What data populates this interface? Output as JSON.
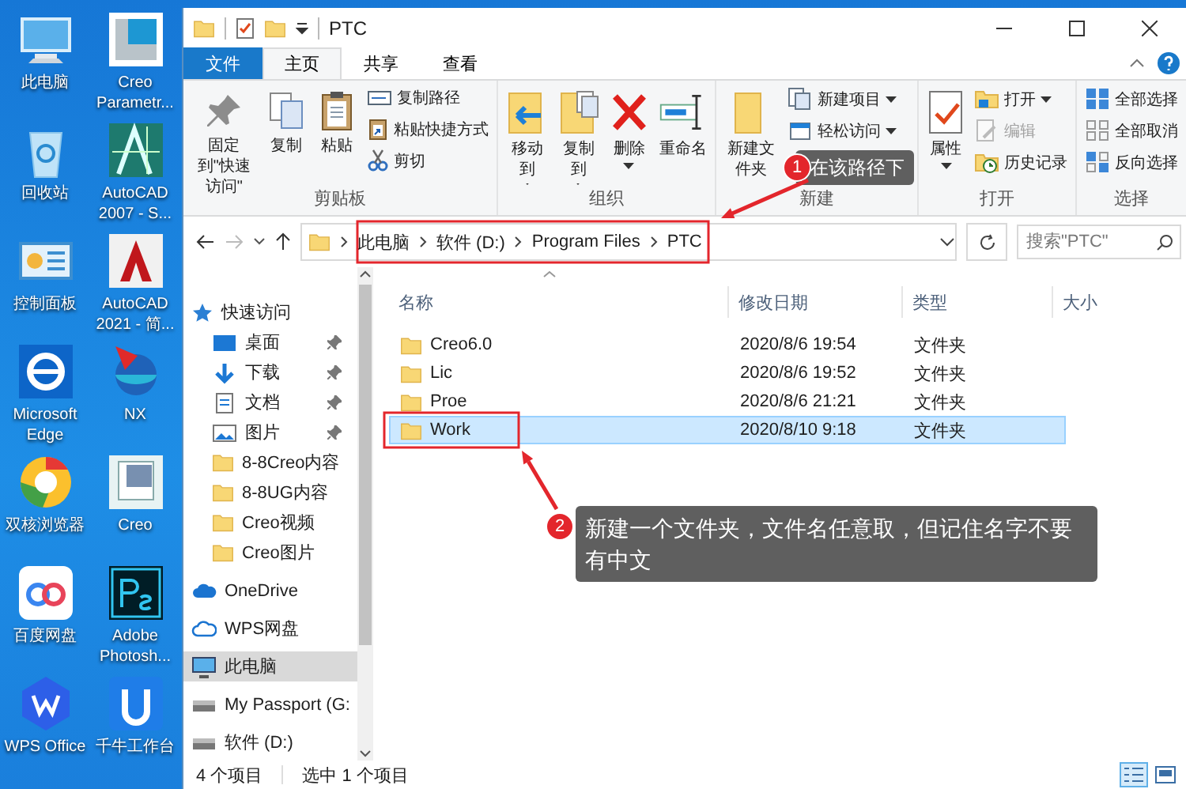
{
  "desktop_icons": [
    {
      "label": "此电脑"
    },
    {
      "label": "Creo Parametr..."
    },
    {
      "label": "回收站"
    },
    {
      "label": "AutoCAD 2007 - S..."
    },
    {
      "label": "控制面板"
    },
    {
      "label": "AutoCAD 2021 - 简..."
    },
    {
      "label": "Microsoft Edge"
    },
    {
      "label": "NX"
    },
    {
      "label": "双核浏览器"
    },
    {
      "label": "Creo"
    },
    {
      "label": "百度网盘"
    },
    {
      "label": "Adobe Photosh..."
    },
    {
      "label": "WPS Office"
    },
    {
      "label": "千牛工作台"
    }
  ],
  "window": {
    "title": "PTC"
  },
  "tabs": [
    {
      "label": "文件",
      "kind": "file",
      "selected": false
    },
    {
      "label": "主页",
      "kind": "tab",
      "selected": true
    },
    {
      "label": "共享",
      "kind": "tab",
      "selected": false
    },
    {
      "label": "查看",
      "kind": "tab",
      "selected": false
    }
  ],
  "ribbon": [
    {
      "label": "剪贴板",
      "items": [
        {
          "label": "固定到\"快速访问\"",
          "kind": "big",
          "dropdown": false,
          "disabled": false
        },
        {
          "label": "复制",
          "kind": "big",
          "dropdown": false,
          "disabled": false
        },
        {
          "label": "粘贴",
          "kind": "big",
          "dropdown": false,
          "disabled": false
        },
        {
          "label": "复制路径",
          "kind": "small",
          "dropdown": false,
          "disabled": false
        },
        {
          "label": "粘贴快捷方式",
          "kind": "small",
          "dropdown": false,
          "disabled": false
        },
        {
          "label": "剪切",
          "kind": "small",
          "dropdown": false,
          "disabled": false
        }
      ]
    },
    {
      "label": "组织",
      "items": [
        {
          "label": "移动到",
          "kind": "big",
          "dropdown": true,
          "disabled": false
        },
        {
          "label": "复制到",
          "kind": "big",
          "dropdown": true,
          "disabled": false
        },
        {
          "label": "删除",
          "kind": "big",
          "dropdown": true,
          "disabled": false
        },
        {
          "label": "重命名",
          "kind": "big",
          "dropdown": false,
          "disabled": false
        }
      ]
    },
    {
      "label": "新建",
      "items": [
        {
          "label": "新建文件夹",
          "kind": "big",
          "dropdown": false,
          "disabled": false
        },
        {
          "label": "新建项目",
          "kind": "small",
          "dropdown": true,
          "disabled": false
        },
        {
          "label": "轻松访问",
          "kind": "small",
          "dropdown": true,
          "disabled": false
        }
      ]
    },
    {
      "label": "打开",
      "items": [
        {
          "label": "属性",
          "kind": "big",
          "dropdown": true,
          "disabled": false
        },
        {
          "label": "打开",
          "kind": "small",
          "dropdown": true,
          "disabled": false
        },
        {
          "label": "编辑",
          "kind": "small",
          "dropdown": false,
          "disabled": true
        },
        {
          "label": "历史记录",
          "kind": "small",
          "dropdown": false,
          "disabled": false
        }
      ]
    },
    {
      "label": "选择",
      "items": [
        {
          "label": "全部选择",
          "kind": "small",
          "dropdown": false,
          "disabled": false
        },
        {
          "label": "全部取消",
          "kind": "small",
          "dropdown": false,
          "disabled": false
        },
        {
          "label": "反向选择",
          "kind": "small",
          "dropdown": false,
          "disabled": false
        }
      ]
    }
  ],
  "address": {
    "breadcrumb": [
      "此电脑",
      "软件 (D:)",
      "Program Files",
      "PTC"
    ],
    "search_placeholder": "搜索\"PTC\""
  },
  "nav": [
    {
      "label": "快速访问",
      "selected": false,
      "children": [
        {
          "label": "桌面",
          "pinned": true,
          "selected": false
        },
        {
          "label": "下载",
          "pinned": true,
          "selected": false
        },
        {
          "label": "文档",
          "pinned": true,
          "selected": false
        },
        {
          "label": "图片",
          "pinned": true,
          "selected": false
        },
        {
          "label": "8-8Creo内容",
          "pinned": false,
          "selected": false
        },
        {
          "label": "8-8UG内容",
          "pinned": false,
          "selected": false
        },
        {
          "label": "Creo视频",
          "pinned": false,
          "selected": false
        },
        {
          "label": "Creo图片",
          "pinned": false,
          "selected": false
        }
      ]
    },
    {
      "label": "OneDrive",
      "selected": false
    },
    {
      "label": "WPS网盘",
      "selected": false
    },
    {
      "label": "此电脑",
      "selected": true
    },
    {
      "label": "My Passport (G:",
      "selected": false
    },
    {
      "label": "软件 (D:)",
      "selected": false
    }
  ],
  "table": {
    "columns": [
      "名称",
      "修改日期",
      "类型",
      "大小"
    ],
    "rows": [
      {
        "name": "Creo6.0",
        "modified": "2020/8/6 19:54",
        "type": "文件夹",
        "selected": false
      },
      {
        "name": "Lic",
        "modified": "2020/8/6 19:52",
        "type": "文件夹",
        "selected": false
      },
      {
        "name": "Proe",
        "modified": "2020/8/6 21:21",
        "type": "文件夹",
        "selected": false
      },
      {
        "name": "Work",
        "modified": "2020/8/10 9:18",
        "type": "文件夹",
        "selected": true
      }
    ]
  },
  "status_bar": {
    "count": "4 个项目",
    "selection": "选中 1 个项目"
  },
  "views": [
    {
      "kind": "details",
      "selected": true
    },
    {
      "kind": "large-icons",
      "selected": false
    }
  ],
  "annotations": [
    {
      "number": "1",
      "text": "在该路径下"
    },
    {
      "number": "2",
      "text": "新建一个文件夹，文件名任意取，但记住名字不要有中文"
    }
  ]
}
